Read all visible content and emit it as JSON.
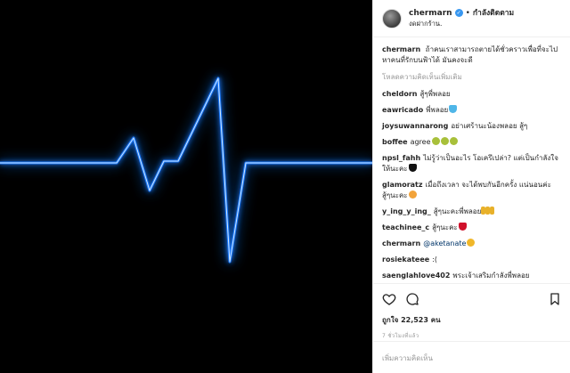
{
  "post": {
    "image_alt": "heartbeat line on black background",
    "accent_color": "#1e7bff"
  },
  "header": {
    "username": "chermarn",
    "separator": "•",
    "follow_label": "กำลังติดตาม",
    "location": "งดฝากร้าน."
  },
  "caption": {
    "user": "chermarn",
    "text": "ถ้าคนเราสามารถตายได้ชั่วคราวเพื่อที่จะไปหาคนที่รักบนฟ้าได้ มันคงจะดี"
  },
  "load_more_label": "โหลดความคิดเห็นเพิ่มเติม",
  "comments": [
    {
      "user": "cheldorn",
      "text": "สู้ๆพี่พลอย",
      "emoji": []
    },
    {
      "user": "eawricado",
      "text": "พี่พลอย",
      "emoji": [
        "blue-heart"
      ]
    },
    {
      "user": "joysuwannarong",
      "text": "อย่าเศร้านะน้องพลอย สู้ๆ",
      "emoji": []
    },
    {
      "user": "boffee",
      "text": "agree",
      "emoji": [
        "crying-face",
        "crying-face",
        "crying-face"
      ]
    },
    {
      "user": "npsl_fahh",
      "text": "ไม่รู้ว่าเป็นอะไร โอเครึเปล่า? แต่เป็นกำลังใจให้นะคะ",
      "emoji": [
        "black-heart"
      ]
    },
    {
      "user": "glamoratz",
      "text": "เมื่อถึงเวลา จะได้พบกันอีกครั้ง แน่นอนค่ะ สู้ๆนะคะ",
      "emoji": [
        "smiling-face"
      ]
    },
    {
      "user": "y_ing_y_ing_",
      "text": "สู้ๆนะคะพี่พลอย",
      "emoji": [
        "hand",
        "hand",
        "hand"
      ]
    },
    {
      "user": "teachinee_c",
      "text": "สู้ๆนะคะ",
      "emoji": [
        "red-heart"
      ]
    },
    {
      "user": "chermarn",
      "text": "@aketanate",
      "emoji": [
        "frowning-face"
      ],
      "is_mention": true
    },
    {
      "user": "rosiekateee",
      "text": ":(",
      "emoji": []
    },
    {
      "user": "saenglahlove402",
      "text": "พระเจ้าเสริมกำลังพี่พลอย",
      "emoji": []
    }
  ],
  "actions": {
    "like_icon": "heart-outline-icon",
    "comment_icon": "comment-bubble-icon",
    "save_icon": "bookmark-icon",
    "likes_text": "ถูกใจ 22,523 คน",
    "timestamp": "7 ชั่วโมงที่แล้ว"
  },
  "add_comment_placeholder": "เพิ่มความคิดเห็น"
}
